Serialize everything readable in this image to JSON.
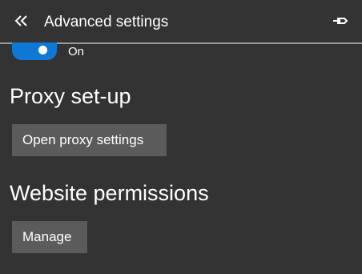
{
  "header": {
    "title": "Advanced settings",
    "back_icon": "chevron-double-left-icon",
    "pin_icon": "pin-icon"
  },
  "toggle": {
    "state": "On",
    "accent_color": "#0f78d4"
  },
  "proxy": {
    "title": "Proxy set-up",
    "button_label": "Open proxy settings"
  },
  "permissions": {
    "title": "Website permissions",
    "button_label": "Manage"
  },
  "colors": {
    "background": "#333333",
    "button": "#5b5b5b",
    "divider": "#9a9a9a",
    "text": "#ffffff"
  }
}
